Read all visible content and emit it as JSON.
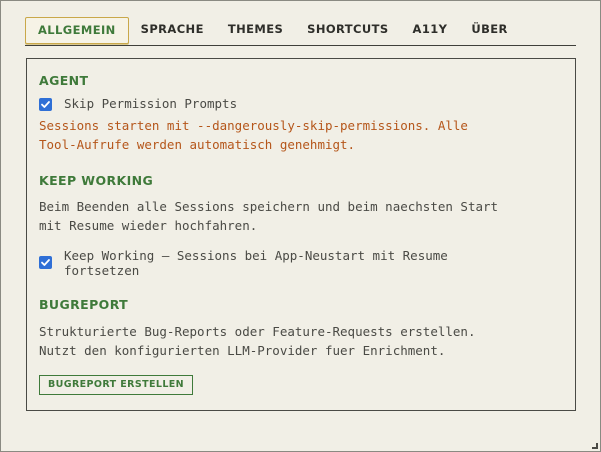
{
  "tabs": [
    {
      "label": "ALLGEMEIN",
      "active": true
    },
    {
      "label": "SPRACHE",
      "active": false
    },
    {
      "label": "THEMES",
      "active": false
    },
    {
      "label": "SHORTCUTS",
      "active": false
    },
    {
      "label": "A11Y",
      "active": false
    },
    {
      "label": "ÜBER",
      "active": false
    }
  ],
  "agent": {
    "title": "AGENT",
    "skip_permissions": {
      "label": "Skip Permission Prompts",
      "checked": true
    },
    "warning_line1": "Sessions starten mit --dangerously-skip-permissions. Alle",
    "warning_line2": "Tool-Aufrufe werden automatisch genehmigt."
  },
  "keep_working": {
    "title": "KEEP WORKING",
    "desc_line1": "Beim Beenden alle Sessions speichern und beim naechsten Start",
    "desc_line2": "mit Resume wieder hochfahren.",
    "checkbox": {
      "label_line1": "Keep Working — Sessions bei App-Neustart mit Resume",
      "label_line2": "fortsetzen",
      "checked": true
    }
  },
  "bugreport": {
    "title": "BUGREPORT",
    "desc_line1": "Strukturierte Bug-Reports oder Feature-Requests erstellen.",
    "desc_line2": "Nutzt den konfigurierten LLM-Provider fuer Enrichment.",
    "button_label": "BUGREPORT ERSTELLEN"
  },
  "colors": {
    "accent_green": "#3f7a3a",
    "warning_orange": "#b5561a",
    "checkbox_blue": "#2f6fd6",
    "active_tab_border": "#c9a84a",
    "background": "#f1efe6"
  }
}
